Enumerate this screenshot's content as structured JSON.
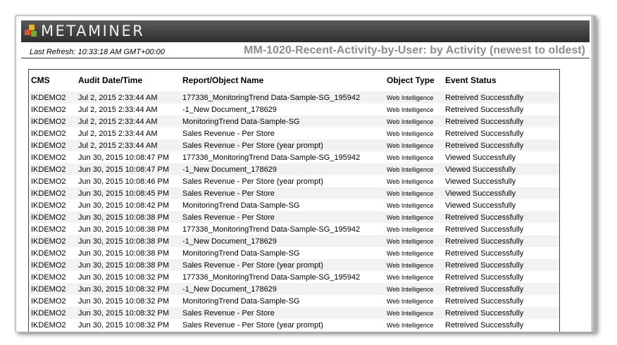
{
  "header": {
    "logo_text": "METAMINER",
    "last_refresh": "Last Refresh: 10:33:18 AM GMT+00:00",
    "report_title": "MM-1020-Recent-Activity-by-User: by Activity (newest to oldest)"
  },
  "table": {
    "columns": [
      "CMS",
      "Audit Date/Time",
      "Report/Object Name",
      "Object Type",
      "Event Status"
    ],
    "rows": [
      [
        "IKDEMO2",
        "Jul 2, 2015 2:33:44 AM",
        "177336_MonitoringTrend Data-Sample-SG_195942",
        "Web Intelligence",
        "Retreived Successfully"
      ],
      [
        "IKDEMO2",
        "Jul 2, 2015 2:33:44 AM",
        "-1_New Document_178629",
        "Web Intelligence",
        "Retreived Successfully"
      ],
      [
        "IKDEMO2",
        "Jul 2, 2015 2:33:44 AM",
        "MonitoringTrend Data-Sample-SG",
        "Web Intelligence",
        "Retreived Successfully"
      ],
      [
        "IKDEMO2",
        "Jul 2, 2015 2:33:44 AM",
        "Sales Revenue - Per Store",
        "Web Intelligence",
        "Retreived Successfully"
      ],
      [
        "IKDEMO2",
        "Jul 2, 2015 2:33:44 AM",
        "Sales Revenue - Per Store (year prompt)",
        "Web Intelligence",
        "Retreived Successfully"
      ],
      [
        "IKDEMO2",
        "Jun 30, 2015 10:08:47 PM",
        "177336_MonitoringTrend Data-Sample-SG_195942",
        "Web Intelligence",
        "Viewed Successfully"
      ],
      [
        "IKDEMO2",
        "Jun 30, 2015 10:08:47 PM",
        "-1_New Document_178629",
        "Web Intelligence",
        "Viewed Successfully"
      ],
      [
        "IKDEMO2",
        "Jun 30, 2015 10:08:46 PM",
        "Sales Revenue - Per Store (year prompt)",
        "Web Intelligence",
        "Viewed Successfully"
      ],
      [
        "IKDEMO2",
        "Jun 30, 2015 10:08:45 PM",
        "Sales Revenue - Per Store",
        "Web Intelligence",
        "Viewed Successfully"
      ],
      [
        "IKDEMO2",
        "Jun 30, 2015 10:08:42 PM",
        "MonitoringTrend Data-Sample-SG",
        "Web Intelligence",
        "Viewed Successfully"
      ],
      [
        "IKDEMO2",
        "Jun 30, 2015 10:08:38 PM",
        "Sales Revenue - Per Store",
        "Web Intelligence",
        "Retreived Successfully"
      ],
      [
        "IKDEMO2",
        "Jun 30, 2015 10:08:38 PM",
        "177336_MonitoringTrend Data-Sample-SG_195942",
        "Web Intelligence",
        "Retreived Successfully"
      ],
      [
        "IKDEMO2",
        "Jun 30, 2015 10:08:38 PM",
        "-1_New Document_178629",
        "Web Intelligence",
        "Retreived Successfully"
      ],
      [
        "IKDEMO2",
        "Jun 30, 2015 10:08:38 PM",
        "MonitoringTrend Data-Sample-SG",
        "Web Intelligence",
        "Retreived Successfully"
      ],
      [
        "IKDEMO2",
        "Jun 30, 2015 10:08:38 PM",
        "Sales Revenue - Per Store (year prompt)",
        "Web Intelligence",
        "Retreived Successfully"
      ],
      [
        "IKDEMO2",
        "Jun 30, 2015 10:08:32 PM",
        "177336_MonitoringTrend Data-Sample-SG_195942",
        "Web Intelligence",
        "Retreived Successfully"
      ],
      [
        "IKDEMO2",
        "Jun 30, 2015 10:08:32 PM",
        "-1_New Document_178629",
        "Web Intelligence",
        "Retreived Successfully"
      ],
      [
        "IKDEMO2",
        "Jun 30, 2015 10:08:32 PM",
        "MonitoringTrend Data-Sample-SG",
        "Web Intelligence",
        "Retreived Successfully"
      ],
      [
        "IKDEMO2",
        "Jun 30, 2015 10:08:32 PM",
        "Sales Revenue - Per Store",
        "Web Intelligence",
        "Retreived Successfully"
      ],
      [
        "IKDEMO2",
        "Jun 30, 2015 10:08:32 PM",
        "Sales Revenue - Per Store (year prompt)",
        "Web Intelligence",
        "Retreived Successfully"
      ]
    ]
  },
  "colors": {
    "banner": "#3a3a3a",
    "title_gray": "#8c8c8c",
    "row_stripe": "#f2f2f2",
    "logo_orange": "#e8b22a",
    "logo_red": "#d9532a",
    "logo_green": "#7aa83a"
  }
}
